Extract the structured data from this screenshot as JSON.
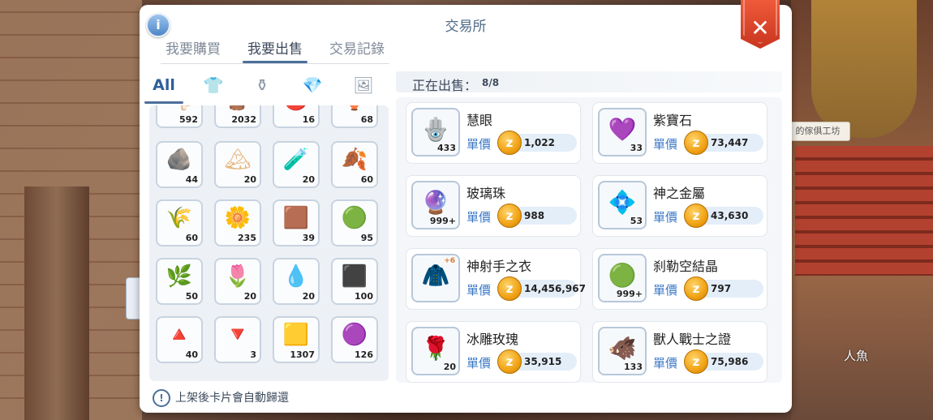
{
  "world": {
    "workshop_sign": "的傢俱工坊",
    "npc_label": "人魚"
  },
  "dialog": {
    "title": "交易所",
    "info_icon": "info-icon",
    "close_icon": "close-icon",
    "close_glyph": "✕",
    "tabs": [
      "我要購買",
      "我要出售",
      "交易記錄"
    ],
    "active_tab": "我要出售"
  },
  "categories": {
    "all_label": "All",
    "items": [
      {
        "icon": "armor-icon",
        "glyph": "👕"
      },
      {
        "icon": "potion-bag-icon",
        "glyph": "⚱"
      },
      {
        "icon": "gem-icon",
        "glyph": "💎"
      },
      {
        "icon": "card-icon",
        "glyph": "🖼"
      }
    ]
  },
  "inventory": {
    "items": [
      {
        "qty": "592",
        "glyph": "🦴",
        "color": "#d8c4b0"
      },
      {
        "qty": "2032",
        "glyph": "🪵",
        "color": "#8a5a44"
      },
      {
        "qty": "16",
        "glyph": "🔴",
        "color": "#c64a2a"
      },
      {
        "qty": "68",
        "glyph": "🏺",
        "color": "#b49a6a"
      },
      {
        "qty": "44",
        "glyph": "🪨",
        "color": "#9a9a8a"
      },
      {
        "qty": "20",
        "glyph": "🏔",
        "color": "#e6b880"
      },
      {
        "qty": "20",
        "glyph": "🧪",
        "color": "#b9d48a"
      },
      {
        "qty": "60",
        "glyph": "🍂",
        "color": "#e56a3a"
      },
      {
        "qty": "60",
        "glyph": "🌾",
        "color": "#e0c060"
      },
      {
        "qty": "235",
        "glyph": "🌼",
        "color": "#e08a3a"
      },
      {
        "qty": "39",
        "glyph": "🟫",
        "color": "#6a4a3a"
      },
      {
        "qty": "95",
        "glyph": "🟢",
        "color": "#8ac25a"
      },
      {
        "qty": "50",
        "glyph": "🌿",
        "color": "#b8c8e0"
      },
      {
        "qty": "20",
        "glyph": "🌷",
        "color": "#d0e0d0"
      },
      {
        "qty": "20",
        "glyph": "💧",
        "color": "#4aa0e0"
      },
      {
        "qty": "100",
        "glyph": "⬛",
        "color": "#555"
      },
      {
        "qty": "40",
        "glyph": "🔺",
        "color": "#e04040"
      },
      {
        "qty": "3",
        "glyph": "🔻",
        "color": "#c85030"
      },
      {
        "qty": "1307",
        "glyph": "🟨",
        "color": "#f0c030"
      },
      {
        "qty": "126",
        "glyph": "🟣",
        "color": "#7a4a9a"
      }
    ]
  },
  "selling": {
    "header_label": "正在出售：",
    "count": "8/8",
    "unit_label": "單價",
    "coin_glyph": "z",
    "items": [
      {
        "name": "慧眼",
        "qty": "433",
        "price": "1,022",
        "icon": "eye-amulet-icon",
        "glyph": "🪬",
        "plus": ""
      },
      {
        "name": "紫寶石",
        "qty": "33",
        "price": "73,447",
        "icon": "amethyst-icon",
        "glyph": "💜",
        "plus": ""
      },
      {
        "name": "玻璃珠",
        "qty": "999+",
        "price": "988",
        "icon": "glass-bead-icon",
        "glyph": "🔮",
        "plus": ""
      },
      {
        "name": "神之金屬",
        "qty": "53",
        "price": "43,630",
        "icon": "crystal-icon",
        "glyph": "💠",
        "plus": ""
      },
      {
        "name": "神射手之衣",
        "qty": "",
        "price": "14,456,967",
        "icon": "armor-icon",
        "glyph": "🧥",
        "plus": "+6"
      },
      {
        "name": "刹勒空結晶",
        "qty": "999+",
        "price": "797",
        "icon": "green-orb-icon",
        "glyph": "🟢",
        "plus": ""
      },
      {
        "name": "冰雕玫瑰",
        "qty": "20",
        "price": "35,915",
        "icon": "ice-rose-icon",
        "glyph": "🌹",
        "plus": ""
      },
      {
        "name": "獸人戰士之證",
        "qty": "133",
        "price": "75,986",
        "icon": "orc-badge-icon",
        "glyph": "🐗",
        "plus": ""
      }
    ]
  },
  "footer": {
    "note": "上架後卡片會自動歸還",
    "icon": "info-icon",
    "glyph": "!"
  }
}
